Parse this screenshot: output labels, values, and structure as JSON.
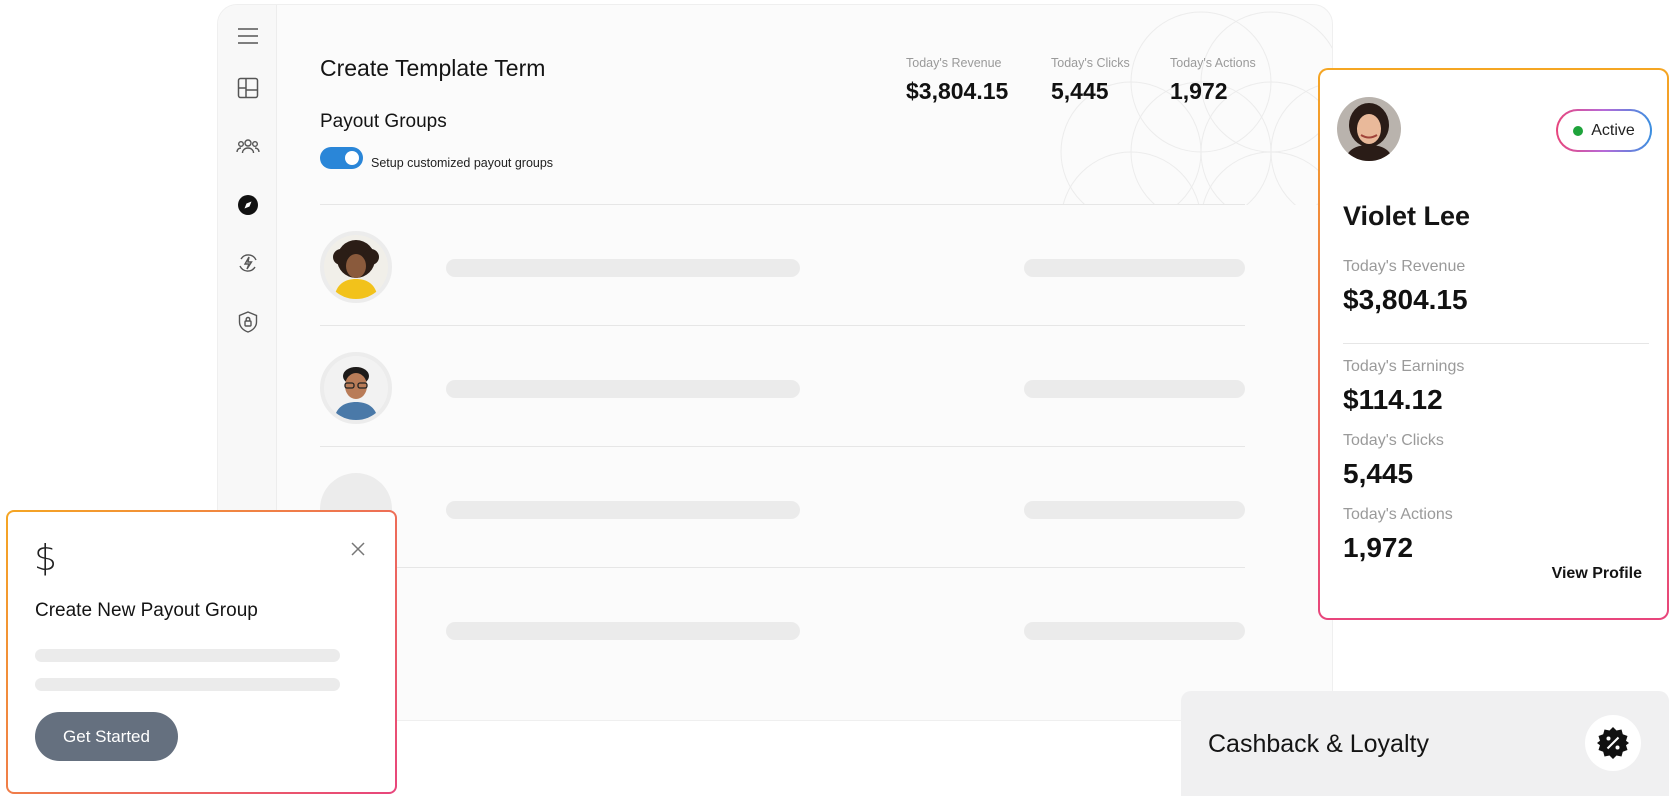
{
  "app": {
    "title": "Create Template Term",
    "subtitle": "Payout Groups",
    "toggle_label": "Setup customized payout groups",
    "stats": [
      {
        "label": "Today's Revenue",
        "value": "$3,804.15"
      },
      {
        "label": "Today's Clicks",
        "value": "5,445"
      },
      {
        "label": "Today's Actions",
        "value": "1,972"
      }
    ],
    "sidebar_icons": [
      "menu-icon",
      "dashboard-icon",
      "users-icon",
      "compass-icon",
      "lightning-refresh-icon",
      "shield-icon"
    ]
  },
  "modal": {
    "icon": "dollar-icon",
    "title": "Create New Payout Group",
    "button": "Get Started"
  },
  "profile": {
    "status": "Active",
    "name": "Violet Lee",
    "stats": [
      {
        "label": "Today's Revenue",
        "value": "$3,804.15"
      },
      {
        "label": "Today's Earnings",
        "value": "$114.12"
      },
      {
        "label": "Today's Clicks",
        "value": "5,445"
      },
      {
        "label": "Today's Actions",
        "value": "1,972"
      }
    ],
    "view_profile": "View Profile"
  },
  "cashback": {
    "label": "Cashback & Loyalty",
    "icon": "percent-badge-icon"
  },
  "colors": {
    "toggle": "#2a86d8",
    "active_dot": "#1ea33b",
    "button": "#65707f",
    "gradient_start": "#f5a623",
    "gradient_end": "#e8457c"
  }
}
